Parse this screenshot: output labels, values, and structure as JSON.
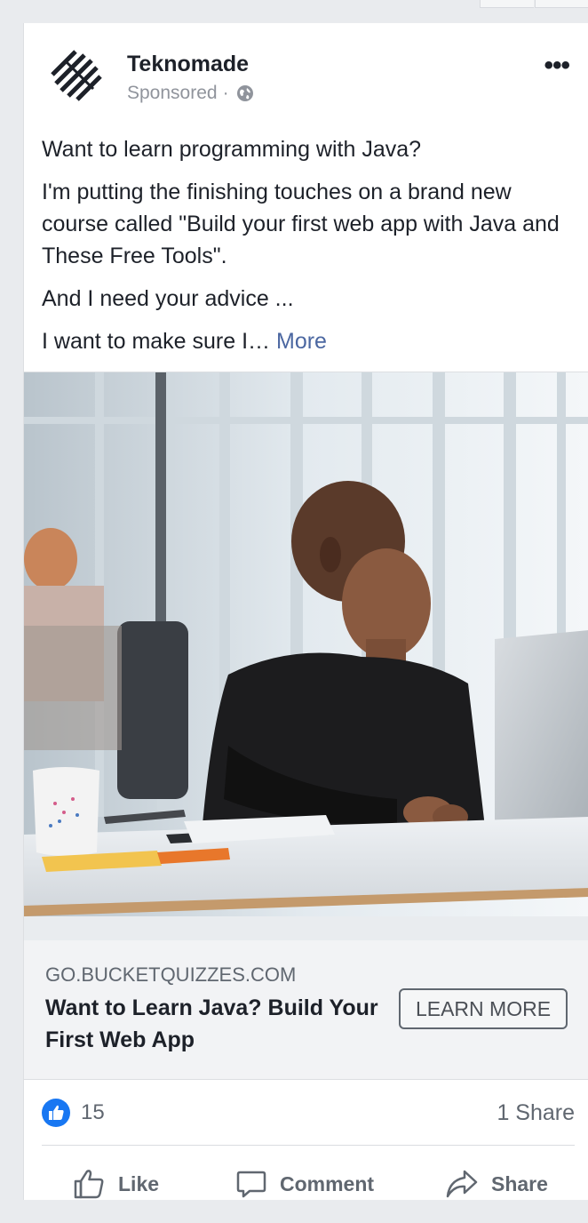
{
  "post": {
    "page_name": "Teknomade",
    "sponsored_label": "Sponsored",
    "separator": "·",
    "menu_glyph": "•••",
    "icons": {
      "logo": "teknomade-logo",
      "audience": "globe-icon",
      "menu": "more-options-icon"
    },
    "text": {
      "line1": "Want to learn programming with Java?",
      "line2": "I'm putting the finishing touches on a brand new course called \"Build your first web app with Java and These Free Tools\".",
      "line3": "And I need your advice ...",
      "line4": "I want to make sure I…",
      "more_link": "More"
    }
  },
  "link_preview": {
    "domain": "GO.BUCKETQUIZZES.COM",
    "headline": "Want to Learn Java? Build Your First Web App",
    "cta_label": "LEARN MORE"
  },
  "stats": {
    "like_count": "15",
    "share_count": "1 Share"
  },
  "actions": {
    "like_label": "Like",
    "comment_label": "Comment",
    "share_label": "Share"
  },
  "colors": {
    "link_blue": "#4b67a1",
    "like_blue": "#1877f2",
    "text_dark": "#1d2129",
    "text_muted": "#606770",
    "card_bg": "#ffffff",
    "page_bg": "#e9ebee"
  }
}
